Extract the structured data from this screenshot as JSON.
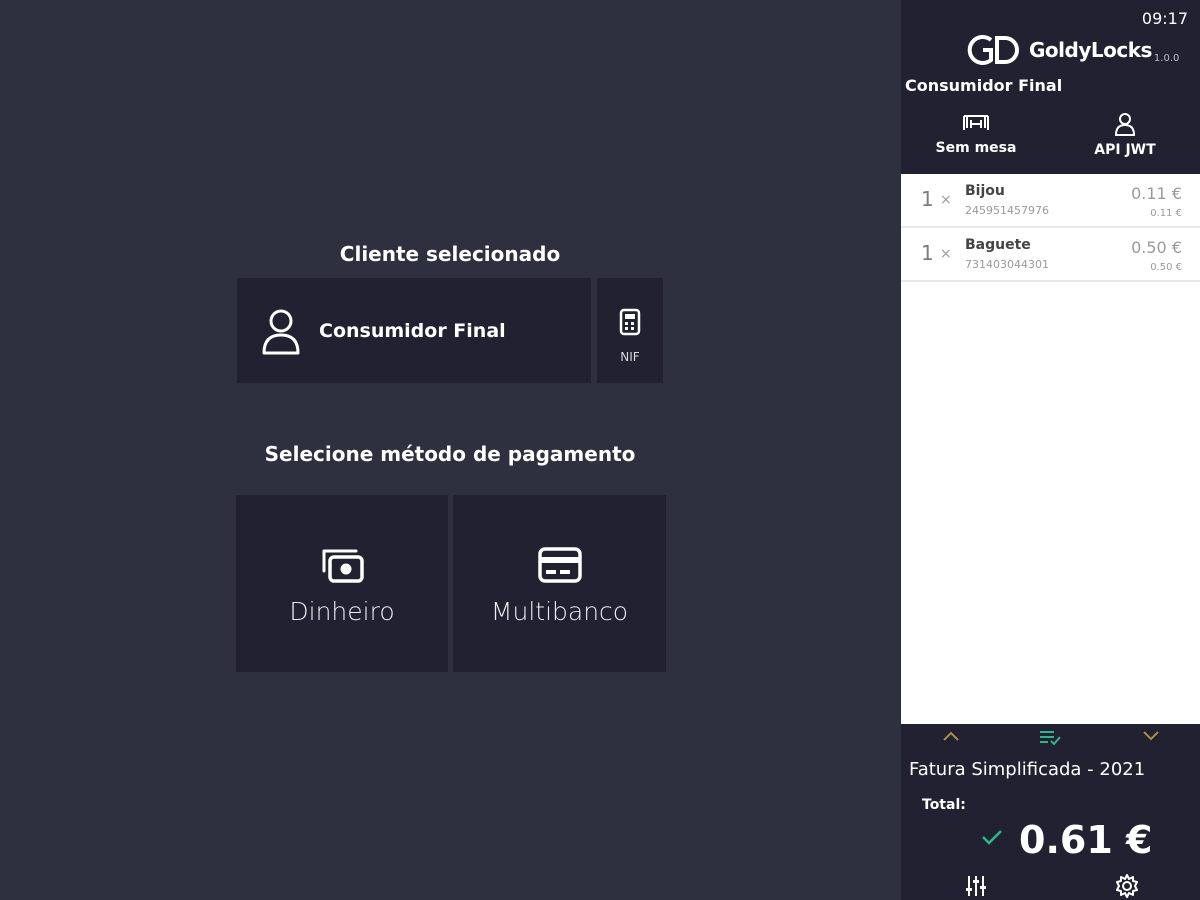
{
  "main": {
    "client_section_title": "Cliente selecionado",
    "client_name": "Consumidor Final",
    "nif_label": "NIF",
    "payment_section_title": "Selecione método de pagamento",
    "payment_methods": [
      {
        "label": "Dinheiro",
        "icon": "cash-icon"
      },
      {
        "label": "Multibanco",
        "icon": "card-icon"
      }
    ]
  },
  "sidebar": {
    "clock": "09:17",
    "logo_text": "GoldyLocks",
    "logo_version": "1.0.0",
    "customer": "Consumidor Final",
    "table_label": "Sem mesa",
    "user_label": "API JWT",
    "items": [
      {
        "qty": "1",
        "times": "×",
        "name": "Bijou",
        "code": "2459514579​76",
        "price": "0.11 €",
        "unit_price": "0.11 €"
      },
      {
        "qty": "1",
        "times": "×",
        "name": "Baguete",
        "code": "731403044301",
        "price": "0.50 €",
        "unit_price": "0.50 €"
      }
    ],
    "document_type": "Fatura Simplificada - 2021",
    "total_label": "Total:",
    "total_value": "0.61 €"
  },
  "colors": {
    "background": "#2e3040",
    "tile": "#222131",
    "accent_green": "#2fb58a",
    "arrow_gold": "#a58f4b"
  }
}
